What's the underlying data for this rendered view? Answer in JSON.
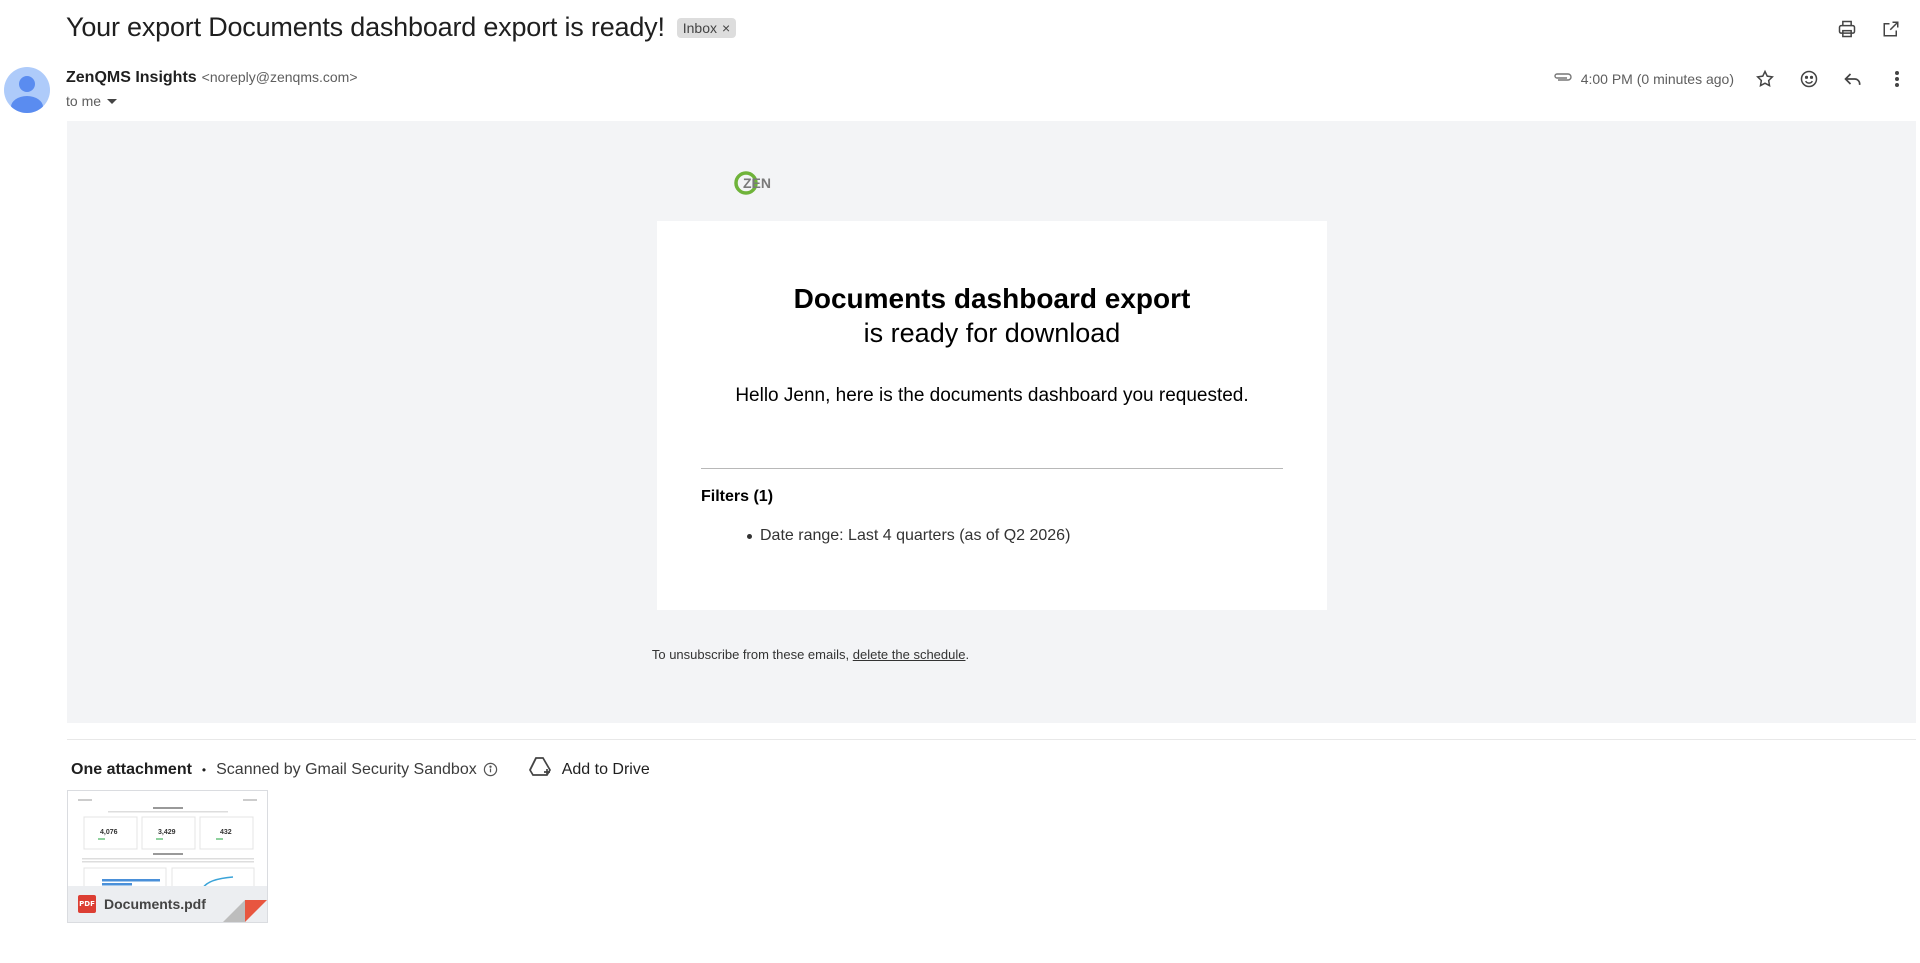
{
  "subject": "Your export Documents dashboard export is ready!",
  "label_chip": {
    "text": "Inbox",
    "remove": "×"
  },
  "sender": {
    "name": "ZenQMS Insights",
    "email": "<noreply@zenqms.com>",
    "recipient": "to me"
  },
  "timestamp": "4:00 PM (0 minutes ago)",
  "logo": {
    "text": "ZEN"
  },
  "card": {
    "title": "Documents dashboard export",
    "subtitle": "is ready for download",
    "greeting": "Hello Jenn, here is the documents dashboard you requested.",
    "filters_heading": "Filters (1)",
    "filters": [
      "Date range: Last 4 quarters (as of Q2 2026)"
    ]
  },
  "footer": {
    "text": "To unsubscribe from these emails, ",
    "link": "delete the schedule",
    "end": "."
  },
  "attachments": {
    "count_label": "One attachment",
    "separator": "•",
    "scan_text": "Scanned by Gmail Security Sandbox",
    "drive_label": "Add to Drive",
    "file": {
      "name": "Documents.pdf",
      "type_badge": "PDF"
    },
    "thumbnail": {
      "values": [
        "4,076",
        "3,429",
        "432"
      ]
    }
  },
  "icons": {
    "print": "print-icon",
    "open_new": "open-in-new-window-icon",
    "attachment": "paperclip-icon",
    "star": "star-icon",
    "emoji": "emoji-icon",
    "reply": "reply-icon",
    "more": "more-vert-icon"
  },
  "colors": {
    "email_bg": "#f3f4f6",
    "chip_bg": "#dddddd",
    "pdf_red": "#dc3e33",
    "avatar": "#aecbfa"
  }
}
